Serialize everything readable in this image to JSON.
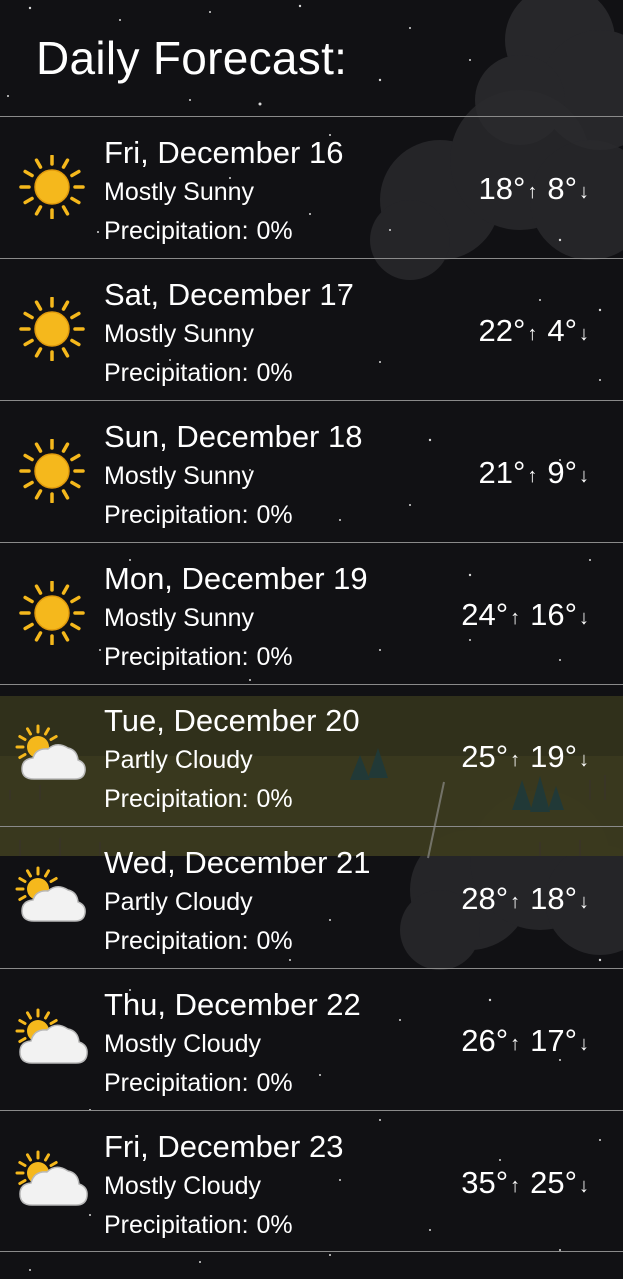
{
  "header": {
    "title": "Daily Forecast:"
  },
  "precip_label": "Precipitation:",
  "arrows": {
    "high": "↑",
    "low": "↓"
  },
  "days": [
    {
      "date": "Fri, December 16",
      "condition": "Mostly Sunny",
      "precipitation": "0%",
      "high": "18°",
      "low": "8°",
      "icon": "sun-icon"
    },
    {
      "date": "Sat, December 17",
      "condition": "Mostly Sunny",
      "precipitation": "0%",
      "high": "22°",
      "low": "4°",
      "icon": "sun-icon"
    },
    {
      "date": "Sun, December 18",
      "condition": "Mostly Sunny",
      "precipitation": "0%",
      "high": "21°",
      "low": "9°",
      "icon": "sun-icon"
    },
    {
      "date": "Mon, December 19",
      "condition": "Mostly Sunny",
      "precipitation": "0%",
      "high": "24°",
      "low": "16°",
      "icon": "sun-icon"
    },
    {
      "date": "Tue, December 20",
      "condition": "Partly Cloudy",
      "precipitation": "0%",
      "high": "25°",
      "low": "19°",
      "icon": "partly-cloudy-icon"
    },
    {
      "date": "Wed, December 21",
      "condition": "Partly Cloudy",
      "precipitation": "0%",
      "high": "28°",
      "low": "18°",
      "icon": "partly-cloudy-icon"
    },
    {
      "date": "Thu, December 22",
      "condition": "Mostly Cloudy",
      "precipitation": "0%",
      "high": "26°",
      "low": "17°",
      "icon": "mostly-cloudy-icon"
    },
    {
      "date": "Fri, December 23",
      "condition": "Mostly Cloudy",
      "precipitation": "0%",
      "high": "35°",
      "low": "25°",
      "icon": "mostly-cloudy-icon"
    }
  ],
  "colors": {
    "background": "#0d0d10",
    "divider": "#8a8a8a",
    "sun": "#f5b81c",
    "cloud": "#f2f2f2",
    "meadow": "#3a3a1e"
  }
}
